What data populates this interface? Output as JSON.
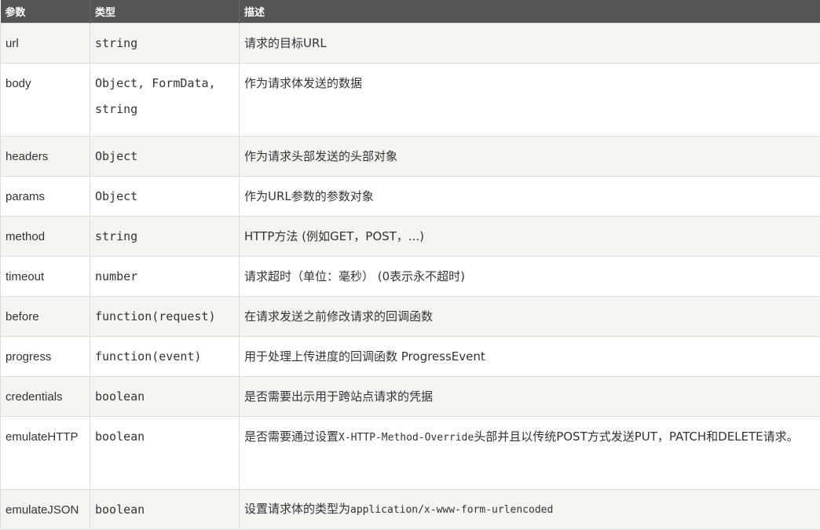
{
  "table": {
    "headers": [
      "参数",
      "类型",
      "描述"
    ],
    "rows": [
      {
        "name": "url",
        "type": "string",
        "desc": [
          "请求的目标URL"
        ]
      },
      {
        "name": "body",
        "type": "Object, FormData, string",
        "desc": [
          "作为请求体发送的数据"
        ]
      },
      {
        "name": "headers",
        "type": "Object",
        "desc": [
          "作为请求头部发送的头部对象"
        ]
      },
      {
        "name": "params",
        "type": "Object",
        "desc": [
          "作为URL参数的参数对象"
        ]
      },
      {
        "name": "method",
        "type": "string",
        "desc": [
          "HTTP方法 (例如GET，POST，...)"
        ]
      },
      {
        "name": "timeout",
        "type": "number",
        "desc": [
          "请求超时（单位：毫秒） (0表示永不超时)"
        ]
      },
      {
        "name": "before",
        "type": "function(request)",
        "desc": [
          "在请求发送之前修改请求的回调函数"
        ]
      },
      {
        "name": "progress",
        "type": "function(event)",
        "desc": [
          "用于处理上传进度的回调函数 ProgressEvent"
        ]
      },
      {
        "name": "credentials",
        "type": "boolean",
        "desc": [
          "是否需要出示用于跨站点请求的凭据"
        ]
      },
      {
        "name": "emulateHTTP",
        "type": "boolean",
        "desc": [
          "是否需要通过设置",
          "X-HTTP-Method-Override",
          "头部并且以传统POST方式发送PUT，PATCH和DELETE请求。"
        ]
      },
      {
        "name": "emulateJSON",
        "type": "boolean",
        "desc": [
          "设置请求体的类型为",
          "application/x-www-form-urlencoded",
          ""
        ]
      }
    ]
  }
}
